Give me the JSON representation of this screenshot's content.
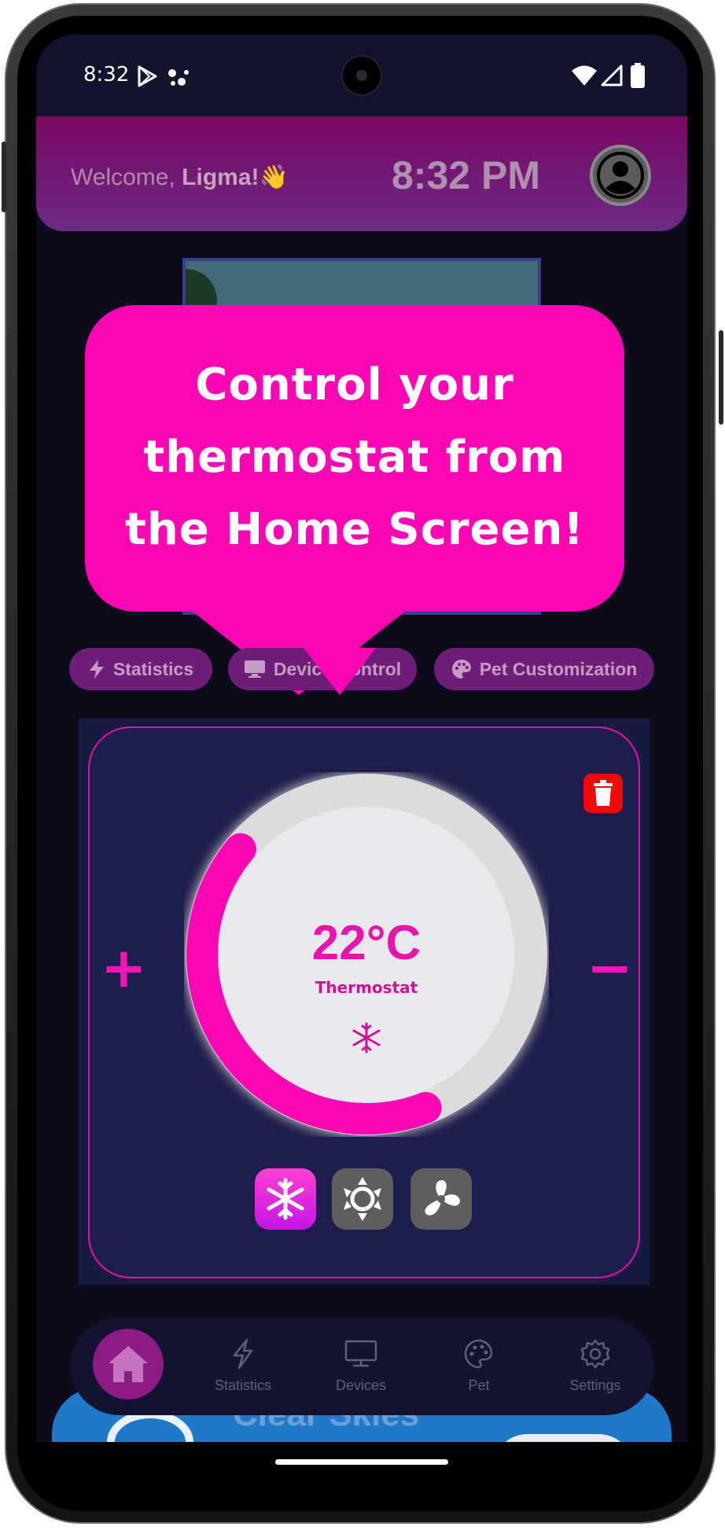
{
  "status_bar": {
    "time": "8:32"
  },
  "header": {
    "welcome_prefix": "Welcome, ",
    "user_name": "Ligma!",
    "wave_emoji": "👋",
    "clock": "8:32 PM"
  },
  "tooltip": {
    "line1": "Control your",
    "line2": "thermostat from",
    "line3": "the Home Screen!"
  },
  "chips": [
    {
      "label": "Statistics",
      "icon": "lightning-icon"
    },
    {
      "label": "Device Control",
      "icon": "monitor-icon"
    },
    {
      "label": "Pet Customization",
      "icon": "palette-icon"
    }
  ],
  "thermostat": {
    "temperature": "22°C",
    "label": "Thermostat",
    "plus": "+",
    "minus": "−",
    "level_fraction": 0.42,
    "modes": [
      "snowflake-icon",
      "sun-icon",
      "fan-icon"
    ],
    "active_mode": "cool"
  },
  "weather": {
    "label": "Clear Skies"
  },
  "nav": {
    "items": [
      {
        "label": "Statistics",
        "icon": "lightning-icon"
      },
      {
        "label": "Devices",
        "icon": "monitor-icon"
      },
      {
        "label": "Pet",
        "icon": "palette-icon"
      },
      {
        "label": "Settings",
        "icon": "gear-icon"
      }
    ]
  },
  "colors": {
    "accent": "#ff06b5",
    "panel": "#1e1e4c",
    "background": "#0c0c1c",
    "delete": "#ee0b0b"
  }
}
